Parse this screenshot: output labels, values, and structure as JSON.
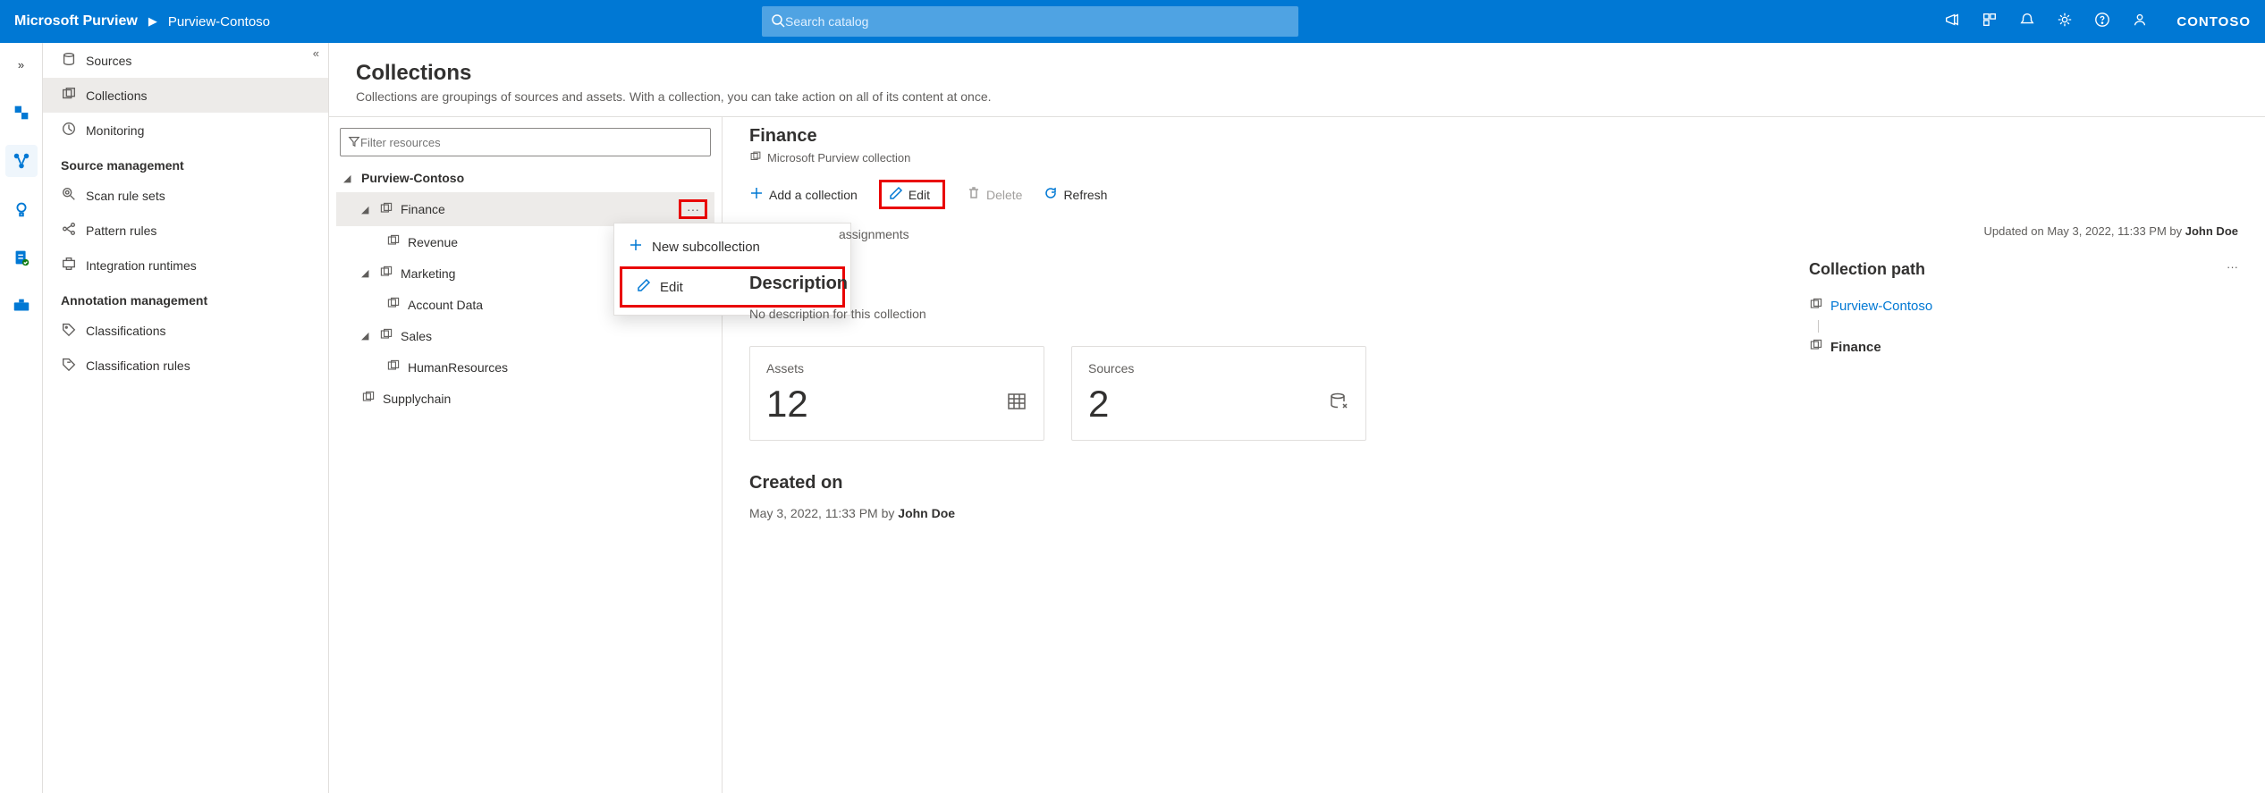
{
  "header": {
    "brand": "Microsoft Purview",
    "breadcrumb": "Purview-Contoso",
    "search_placeholder": "Search catalog",
    "tenant": "CONTOSO"
  },
  "sidebar": {
    "top": [
      {
        "label": "Sources"
      },
      {
        "label": "Collections"
      },
      {
        "label": "Monitoring"
      }
    ],
    "group1_title": "Source management",
    "group1": [
      {
        "label": "Scan rule sets"
      },
      {
        "label": "Pattern rules"
      },
      {
        "label": "Integration runtimes"
      }
    ],
    "group2_title": "Annotation management",
    "group2": [
      {
        "label": "Classifications"
      },
      {
        "label": "Classification rules"
      }
    ]
  },
  "page": {
    "title": "Collections",
    "subtitle": "Collections are groupings of sources and assets. With a collection, you can take action on all of its content at once."
  },
  "filter_placeholder": "Filter resources",
  "tree": {
    "root": "Purview-Contoso",
    "items": [
      {
        "label": "Finance",
        "children": [
          "Revenue"
        ]
      },
      {
        "label": "Marketing",
        "children": [
          "Account Data"
        ]
      },
      {
        "label": "Sales",
        "children": [
          "HumanResources"
        ]
      },
      {
        "label": "Supplychain",
        "children": []
      }
    ]
  },
  "contextmenu": {
    "new_sub": "New subcollection",
    "edit": "Edit"
  },
  "detail": {
    "title": "Finance",
    "type": "Microsoft Purview collection",
    "cmd_add": "Add a collection",
    "cmd_edit": "Edit",
    "cmd_delete": "Delete",
    "cmd_refresh": "Refresh",
    "tab_roles": "assignments",
    "updated_prefix": "Updated on ",
    "updated_date": "May 3, 2022, 11:33 PM by ",
    "updated_by": "John Doe",
    "desc_heading": "Description",
    "desc_text": "No description for this collection",
    "assets_label": "Assets",
    "assets_value": "12",
    "sources_label": "Sources",
    "sources_value": "2",
    "created_heading": "Created on",
    "created_text": "May 3, 2022, 11:33 PM by ",
    "created_by": "John Doe",
    "path_heading": "Collection path",
    "path_root": "Purview-Contoso",
    "path_current": "Finance"
  }
}
